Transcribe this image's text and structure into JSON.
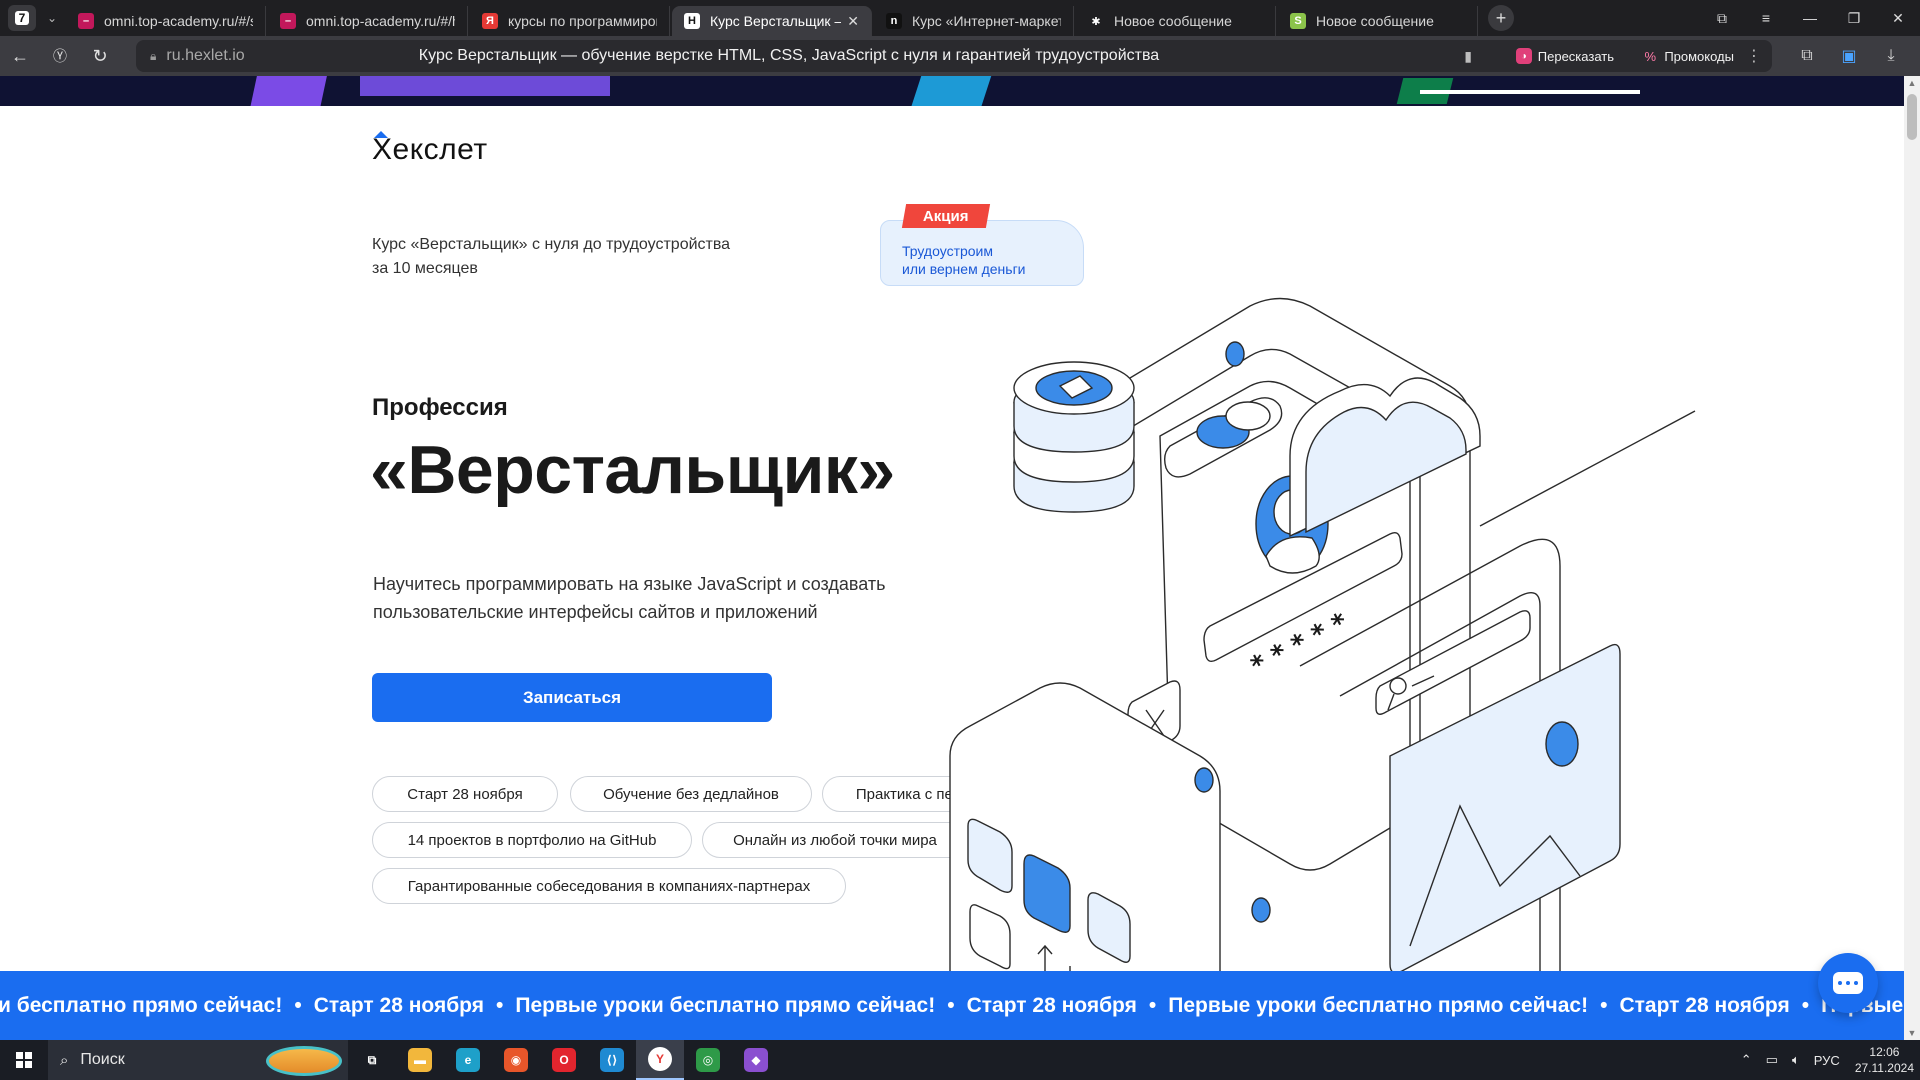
{
  "browser": {
    "tab_count": "7",
    "tabs": [
      {
        "title": "omni.top-academy.ru/#/s",
        "fav_color": "#c2185b",
        "fav_text": "–"
      },
      {
        "title": "omni.top-academy.ru/#/h",
        "fav_color": "#c2185b",
        "fav_text": "–"
      },
      {
        "title": "курсы по программиров",
        "fav_color": "#e53935",
        "fav_text": "Я"
      },
      {
        "title": "Курс Верстальщик — о",
        "fav_color": "#ffffff",
        "fav_text": "H",
        "active": true
      },
      {
        "title": "Курс «Интернет-маркето",
        "fav_color": "#111111",
        "fav_text": "n"
      },
      {
        "title": "Новое сообщение",
        "fav_color": "transparent",
        "fav_text": "✱"
      },
      {
        "title": "Новое сообщение",
        "fav_color": "#8bc34a",
        "fav_text": "S"
      }
    ],
    "url_domain": "ru.hexlet.io",
    "page_title": "Курс Верстальщик — обучение верстке HTML, CSS, JavaScript с нуля и гарантией трудоустройства",
    "retell_label": "Пересказать",
    "promo_label": "Промокоды"
  },
  "page": {
    "logo": "Хекслет",
    "subtitle_line1": "Курс «Верстальщик» с нуля до трудоустройства",
    "subtitle_line2": "за 10 месяцев",
    "badge_tag": "Акция",
    "badge_line1": "Трудоустроим",
    "badge_line2": "или вернем деньги",
    "profession_label": "Профессия",
    "profession_title": "«Верстальщик»",
    "description_line1": "Научитесь программировать на языке JavaScript и создавать",
    "description_line2": "пользовательские интерфейсы сайтов и приложений",
    "cta_label": "Записаться",
    "chips": [
      "Старт 28 ноября",
      "Обучение без дедлайнов",
      "Практика с первого дня",
      "14 проектов в портфолио на GitHub",
      "Онлайн из любой точки мира",
      "Гарантированные собеседования в компаниях-партнерах"
    ],
    "ticker_items": [
      "и бесплатно прямо сейчас!",
      "Старт 28 ноября",
      "Первые уроки бесплатно прямо сейчас!",
      "Старт 28 ноября",
      "Первые уроки бесплатно прямо сейчас!",
      "Старт 28 ноября",
      "Первые уроки бесплатно прямо сейчас!"
    ],
    "ticker_separator": "•",
    "password_mask": "* * * * *"
  },
  "taskbar": {
    "search_placeholder": "Поиск",
    "apps": [
      {
        "name": "task-view",
        "color": "transparent",
        "glyph": "⧉"
      },
      {
        "name": "file-explorer",
        "color": "#f2b73c",
        "glyph": "▬"
      },
      {
        "name": "edge",
        "color": "#1ea0c9",
        "glyph": "e"
      },
      {
        "name": "firefox",
        "color": "#e8562a",
        "glyph": "◉"
      },
      {
        "name": "opera",
        "color": "#e2252e",
        "glyph": "O"
      },
      {
        "name": "vscode",
        "color": "#1f8ad2",
        "glyph": "⟨⟩"
      },
      {
        "name": "yandex-browser",
        "color": "#ffffff",
        "glyph": "Y",
        "active": true
      },
      {
        "name": "chrome",
        "color": "#2e9a48",
        "glyph": "◎"
      },
      {
        "name": "visual-studio",
        "color": "#8a4fd0",
        "glyph": "◆"
      }
    ],
    "lang": "РУС",
    "time": "12:06",
    "date": "27.11.2024"
  },
  "colors": {
    "brand_blue": "#1a6df0",
    "promo_red": "#f0463c",
    "illus_fill": "#e7f1fd"
  }
}
